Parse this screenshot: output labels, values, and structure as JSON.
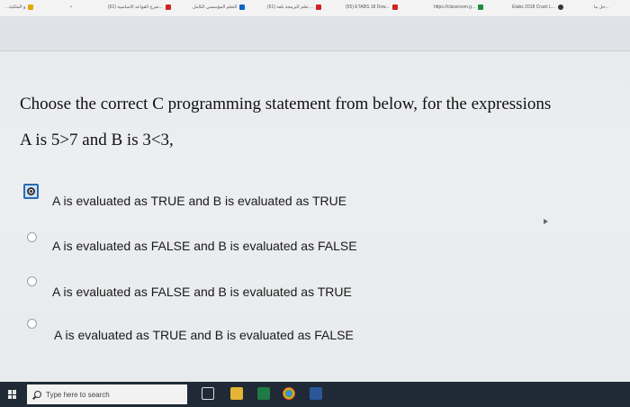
{
  "bookmarks": [
    {
      "label": "...و الملكية",
      "icon": "bookmark-icon"
    },
    {
      "label": "(61) شرح القواعد الاساسية...",
      "icon": "youtube-icon"
    },
    {
      "label": "التعلم المؤسسي الكامل",
      "icon": "linkedin-icon"
    },
    {
      "label": "(61) تعلم البرمجة بلغة ...",
      "icon": "youtube-icon"
    },
    {
      "label": "(55) ETABS 18 Dow...",
      "icon": "youtube-icon"
    },
    {
      "label": "https://classroom.g...",
      "icon": "classroom-icon"
    },
    {
      "label": "Etabs 2018 Crack L...",
      "icon": "github-icon"
    },
    {
      "label": "حل ما...",
      "icon": "bookmark-icon"
    }
  ],
  "question": {
    "line1": "Choose the correct C programming statement from below, for the expressions",
    "line2": "A is 5>7 and B is 3<3,"
  },
  "options": [
    {
      "label": "A is evaluated as TRUE and B is evaluated as TRUE",
      "selected": true
    },
    {
      "label": "A is evaluated as FALSE and B is evaluated as FALSE",
      "selected": false
    },
    {
      "label": "A is evaluated as FALSE and B is evaluated as TRUE",
      "selected": false
    },
    {
      "label": "A is evaluated as TRUE and B is evaluated as FALSE",
      "selected": false
    }
  ],
  "taskbar": {
    "search_placeholder": "Type here to search",
    "apps": [
      "task-view-icon",
      "file-explorer-icon",
      "excel-icon",
      "chrome-icon",
      "word-icon"
    ]
  }
}
